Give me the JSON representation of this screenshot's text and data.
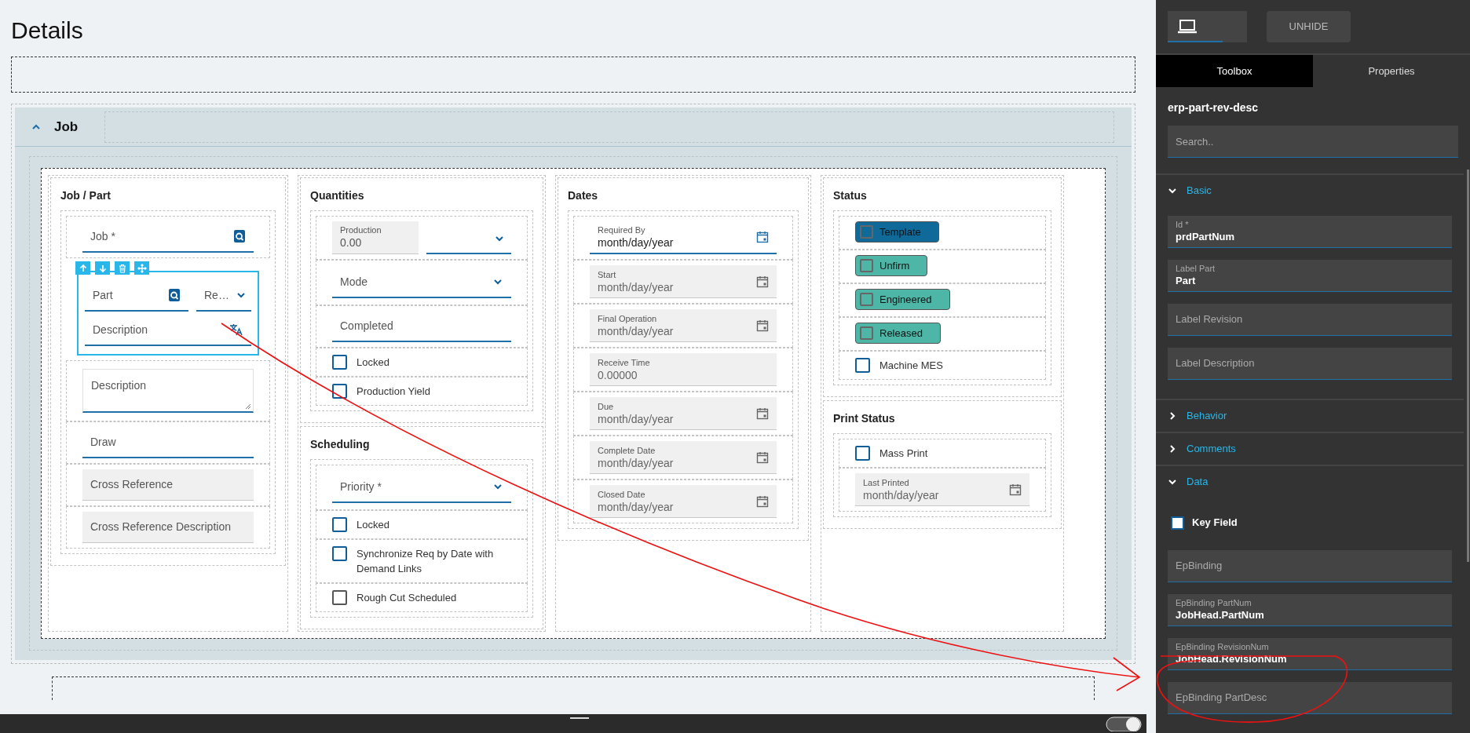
{
  "page_title": "Details",
  "job_panel": {
    "title": "Job",
    "expanded": true,
    "columns": [
      {
        "sections": [
          {
            "title": "Job / Part",
            "fields": [
              {
                "kind": "lookup",
                "label": "Job *"
              },
              {
                "kind": "part-rev-desc",
                "selected": true,
                "part_label": "Part",
                "revision_label": "Re…",
                "description_label": "Description"
              },
              {
                "kind": "textarea",
                "label": "Description"
              },
              {
                "kind": "text",
                "label": "Draw",
                "readonly": false
              },
              {
                "kind": "text",
                "label": "Cross Reference",
                "readonly": true
              },
              {
                "kind": "text",
                "label": "Cross Reference Description",
                "readonly": true
              }
            ]
          }
        ]
      },
      {
        "sections": [
          {
            "title": "Quantities",
            "fields": [
              {
                "kind": "number-unit",
                "label": "Production",
                "value": "0.00"
              },
              {
                "kind": "select",
                "label": "Mode"
              },
              {
                "kind": "text",
                "label": "Completed",
                "readonly": false
              },
              {
                "kind": "checkbox",
                "label": "Locked",
                "checked": false,
                "disabled": false
              },
              {
                "kind": "checkbox",
                "label": "Production Yield",
                "checked": false,
                "disabled": false
              }
            ]
          },
          {
            "title": "Scheduling",
            "fields": [
              {
                "kind": "select",
                "label": "Priority *"
              },
              {
                "kind": "checkbox",
                "label": "Locked",
                "checked": false,
                "disabled": false
              },
              {
                "kind": "checkbox",
                "label": "Synchronize Req by Date with Demand Links",
                "checked": false,
                "disabled": false
              },
              {
                "kind": "checkbox",
                "label": "Rough Cut Scheduled",
                "checked": false,
                "disabled": true
              }
            ]
          }
        ]
      },
      {
        "sections": [
          {
            "title": "Dates",
            "fields": [
              {
                "kind": "date",
                "label": "Required By",
                "value": "month/day/year",
                "readonly": false
              },
              {
                "kind": "date",
                "label": "Start",
                "value": "month/day/year",
                "readonly": true
              },
              {
                "kind": "date",
                "label": "Final Operation",
                "value": "month/day/year",
                "readonly": true
              },
              {
                "kind": "value",
                "label": "Receive Time",
                "value": "0.00000",
                "readonly": true
              },
              {
                "kind": "date",
                "label": "Due",
                "value": "month/day/year",
                "readonly": true
              },
              {
                "kind": "date",
                "label": "Complete Date",
                "value": "month/day/year",
                "readonly": true
              },
              {
                "kind": "date",
                "label": "Closed Date",
                "value": "month/day/year",
                "readonly": true
              }
            ]
          }
        ]
      },
      {
        "sections": [
          {
            "title": "Status",
            "fields": [
              {
                "kind": "chip",
                "label": "Template",
                "checked": false,
                "color": "#0f6a9a"
              },
              {
                "kind": "chip",
                "label": "Unfirm",
                "checked": false,
                "color": "#4db6a6"
              },
              {
                "kind": "chip",
                "label": "Engineered",
                "checked": false,
                "color": "#4db6a6"
              },
              {
                "kind": "chip",
                "label": "Released",
                "checked": false,
                "color": "#4db6a6"
              },
              {
                "kind": "checkbox",
                "label": "Machine MES",
                "checked": false,
                "disabled": false
              }
            ]
          },
          {
            "title": "Print Status",
            "fields": [
              {
                "kind": "checkbox",
                "label": "Mass Print",
                "checked": false,
                "disabled": false
              },
              {
                "kind": "date",
                "label": "Last Printed",
                "value": "month/day/year",
                "readonly": true
              }
            ]
          }
        ]
      }
    ]
  },
  "properties_panel": {
    "unhide_button": "UNHIDE",
    "tabs": [
      {
        "label": "Toolbox",
        "selected": true
      },
      {
        "label": "Properties",
        "selected": false
      }
    ],
    "component_name": "erp-part-rev-desc",
    "search": {
      "placeholder": "Search.."
    },
    "sections": [
      {
        "title": "Basic",
        "expanded": true,
        "items": [
          {
            "kind": "field",
            "label": "Id *",
            "value": "prdPartNum"
          },
          {
            "kind": "field",
            "label": "Label Part",
            "value": "Part"
          },
          {
            "kind": "field",
            "label": "Label Revision"
          },
          {
            "kind": "field",
            "label": "Label Description"
          }
        ]
      },
      {
        "title": "Behavior",
        "expanded": false
      },
      {
        "title": "Comments",
        "expanded": false
      },
      {
        "title": "Data",
        "expanded": true,
        "items": [
          {
            "kind": "checkbox",
            "label": "Key Field",
            "checked": false
          },
          {
            "kind": "field",
            "label": "EpBinding"
          },
          {
            "kind": "field",
            "label": "EpBinding PartNum",
            "value": "JobHead.PartNum"
          },
          {
            "kind": "field",
            "label": "EpBinding RevisionNum",
            "value": "JobHead.RevisionNum"
          },
          {
            "kind": "field",
            "label": "EpBinding PartDesc"
          }
        ]
      }
    ]
  }
}
